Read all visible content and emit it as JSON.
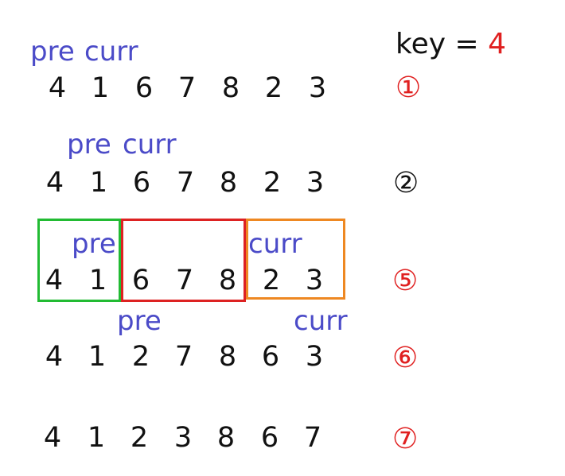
{
  "key": {
    "label": "key = ",
    "value": "4",
    "label_color": "#111111",
    "value_color": "#e02020"
  },
  "colors": {
    "pointer": "#4b4bc8",
    "number": "#111111",
    "step_red": "#e02020",
    "step_black": "#111111",
    "box_green": "#22bb33",
    "box_red": "#dd2222",
    "box_orange": "#ee8822"
  },
  "rows": [
    {
      "step": "①",
      "step_color": "#e02020",
      "numbers": [
        "4",
        "1",
        "6",
        "7",
        "8",
        "2",
        "3"
      ],
      "pointer_labels": [
        "pre",
        "curr"
      ]
    },
    {
      "step": "②",
      "step_color": "#111111",
      "numbers": [
        "4",
        "1",
        "6",
        "7",
        "8",
        "2",
        "3"
      ],
      "pointer_labels": [
        "pre",
        "curr"
      ]
    },
    {
      "step": "⑤",
      "step_color": "#e02020",
      "numbers": [
        "4",
        "1",
        "6",
        "7",
        "8",
        "2",
        "3"
      ],
      "pointer_labels": [
        "pre",
        "curr"
      ],
      "groups": [
        {
          "name": "less-than-key",
          "color": "#22bb33",
          "members": [
            "4",
            "1"
          ]
        },
        {
          "name": "greater-than-key",
          "color": "#dd2222",
          "members": [
            "6",
            "7",
            "8"
          ]
        },
        {
          "name": "unprocessed",
          "color": "#ee8822",
          "members": [
            "2",
            "3"
          ]
        }
      ]
    },
    {
      "step": "⑥",
      "step_color": "#e02020",
      "numbers": [
        "4",
        "1",
        "2",
        "7",
        "8",
        "6",
        "3"
      ],
      "pointer_labels": [
        "pre",
        "curr"
      ]
    },
    {
      "step": "⑦",
      "step_color": "#e02020",
      "numbers": [
        "4",
        "1",
        "2",
        "3",
        "8",
        "6",
        "7"
      ]
    }
  ]
}
